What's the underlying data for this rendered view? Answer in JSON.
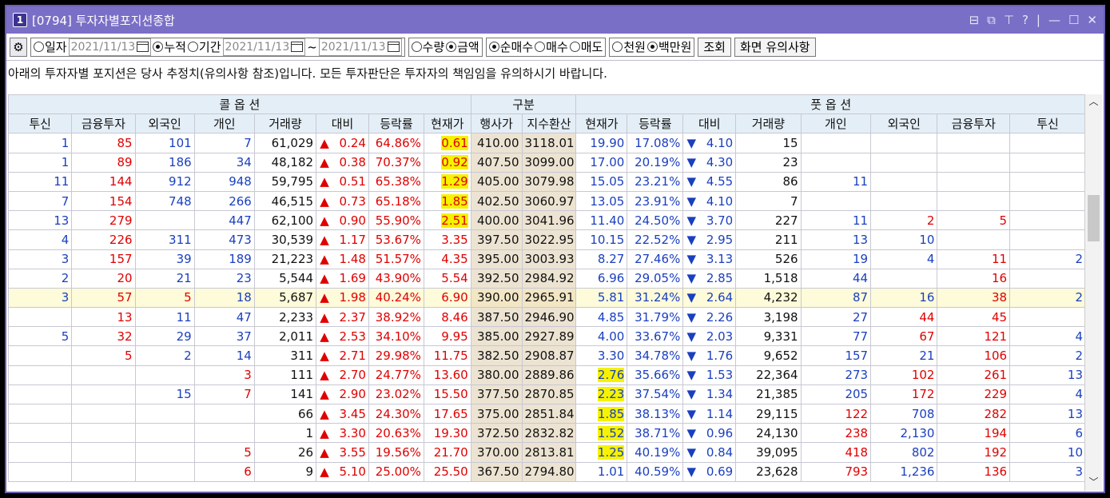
{
  "window": {
    "screen_no": "1",
    "title": "[0794]  투자자별포지션종합",
    "controls": [
      "⊟",
      "⧉",
      "⊤",
      "?",
      "|",
      "—",
      "☐",
      "✕"
    ]
  },
  "toolbar": {
    "radio_daily": "일자",
    "date_single": "2021/11/13",
    "radio_cumulative": "누적",
    "radio_period": "기간",
    "date_from": "2021/11/13",
    "tilde": "~",
    "date_to": "2021/11/13",
    "radio_qty": "수량",
    "radio_amount": "금액",
    "radio_net": "순매수",
    "radio_buy": "매수",
    "radio_sell": "매도",
    "radio_thousand": "천원",
    "radio_million": "백만원",
    "query_button": "조회",
    "notice_button": "화면 유의사항"
  },
  "notice": "아래의 투자자별 포지션은 당사 추정치(유의사항 참조)입니다. 모든 투자판단은 투자자의 책임임을 유의하시기 바랍니다.",
  "header": {
    "call": "콜 옵 션",
    "div": "구분",
    "put": "풋 옵 션",
    "cols": [
      "투신",
      "금융투자",
      "외국인",
      "개인",
      "거래량",
      "대비",
      "등락률",
      "현재가",
      "행사가",
      "지수환산",
      "현재가",
      "등락률",
      "대비",
      "거래량",
      "개인",
      "외국인",
      "금융투자",
      "투신"
    ]
  },
  "symbols": {
    "up": "▲",
    "down": "▼"
  },
  "rows": [
    [
      "1",
      "85",
      "101",
      "7",
      "61,029",
      "0.24",
      "64.86%",
      "0.61",
      "410.00",
      "3118.01",
      "19.90",
      "17.08%",
      "4.10",
      "15",
      "",
      "",
      "",
      ""
    ],
    [
      "1",
      "89",
      "186",
      "34",
      "48,182",
      "0.38",
      "70.37%",
      "0.92",
      "407.50",
      "3099.00",
      "17.00",
      "20.19%",
      "4.30",
      "23",
      "",
      "",
      "",
      ""
    ],
    [
      "11",
      "144",
      "912",
      "948",
      "59,795",
      "0.51",
      "65.38%",
      "1.29",
      "405.00",
      "3079.98",
      "15.05",
      "23.21%",
      "4.55",
      "86",
      "11",
      "",
      "",
      ""
    ],
    [
      "7",
      "154",
      "748",
      "266",
      "46,515",
      "0.73",
      "65.18%",
      "1.85",
      "402.50",
      "3060.97",
      "13.05",
      "23.91%",
      "4.10",
      "7",
      "",
      "",
      "",
      ""
    ],
    [
      "13",
      "279",
      "",
      "447",
      "62,100",
      "0.90",
      "55.90%",
      "2.51",
      "400.00",
      "3041.96",
      "11.40",
      "24.50%",
      "3.70",
      "227",
      "11",
      "2",
      "5",
      ""
    ],
    [
      "4",
      "226",
      "311",
      "473",
      "30,539",
      "1.17",
      "53.67%",
      "3.35",
      "397.50",
      "3022.95",
      "10.15",
      "22.52%",
      "2.95",
      "211",
      "13",
      "10",
      "",
      ""
    ],
    [
      "3",
      "157",
      "39",
      "189",
      "21,223",
      "1.48",
      "51.57%",
      "4.35",
      "395.00",
      "3003.93",
      "8.27",
      "27.46%",
      "3.13",
      "526",
      "19",
      "4",
      "11",
      "2"
    ],
    [
      "2",
      "20",
      "21",
      "23",
      "5,544",
      "1.69",
      "43.90%",
      "5.54",
      "392.50",
      "2984.92",
      "6.96",
      "29.05%",
      "2.85",
      "1,518",
      "44",
      "",
      "16",
      ""
    ],
    [
      "3",
      "57",
      "5",
      "18",
      "5,687",
      "1.98",
      "40.24%",
      "6.90",
      "390.00",
      "2965.91",
      "5.81",
      "31.24%",
      "2.64",
      "4,232",
      "87",
      "16",
      "38",
      "2"
    ],
    [
      "",
      "13",
      "11",
      "47",
      "2,233",
      "2.37",
      "38.92%",
      "8.46",
      "387.50",
      "2946.90",
      "4.85",
      "31.79%",
      "2.26",
      "3,198",
      "27",
      "44",
      "45",
      ""
    ],
    [
      "5",
      "32",
      "29",
      "37",
      "2,011",
      "2.53",
      "34.10%",
      "9.95",
      "385.00",
      "2927.89",
      "4.00",
      "33.67%",
      "2.03",
      "9,331",
      "77",
      "67",
      "121",
      "4"
    ],
    [
      "",
      "5",
      "2",
      "14",
      "311",
      "2.71",
      "29.98%",
      "11.75",
      "382.50",
      "2908.87",
      "3.30",
      "34.78%",
      "1.76",
      "9,652",
      "157",
      "21",
      "106",
      "2"
    ],
    [
      "",
      "",
      "",
      "3",
      "111",
      "2.70",
      "24.77%",
      "13.60",
      "380.00",
      "2889.86",
      "2.76",
      "35.66%",
      "1.53",
      "22,364",
      "273",
      "102",
      "261",
      "13"
    ],
    [
      "",
      "",
      "15",
      "7",
      "141",
      "2.90",
      "23.02%",
      "15.50",
      "377.50",
      "2870.85",
      "2.23",
      "37.54%",
      "1.34",
      "21,385",
      "205",
      "172",
      "229",
      "4"
    ],
    [
      "",
      "",
      "",
      "",
      "66",
      "3.45",
      "24.30%",
      "17.65",
      "375.00",
      "2851.84",
      "1.85",
      "38.13%",
      "1.14",
      "29,115",
      "122",
      "708",
      "282",
      "13"
    ],
    [
      "",
      "",
      "",
      "",
      "1",
      "3.30",
      "20.63%",
      "19.30",
      "372.50",
      "2832.82",
      "1.52",
      "38.71%",
      "0.96",
      "24,130",
      "238",
      "2,130",
      "194",
      "6"
    ],
    [
      "",
      "",
      "",
      "5",
      "26",
      "3.55",
      "19.56%",
      "21.70",
      "370.00",
      "2813.81",
      "1.25",
      "40.19%",
      "0.84",
      "39,095",
      "418",
      "802",
      "192",
      "10"
    ],
    [
      "",
      "",
      "",
      "6",
      "9",
      "5.10",
      "25.00%",
      "25.50",
      "367.50",
      "2794.80",
      "1.01",
      "40.59%",
      "0.69",
      "23,628",
      "793",
      "1,236",
      "136",
      "3"
    ]
  ],
  "call_highlight_rows": [
    0,
    1,
    2,
    3,
    4
  ],
  "put_highlight_rows": [
    12,
    13,
    14,
    15,
    16
  ],
  "atm_row": 8,
  "colors": {
    "title_bg": "#7a6fc6",
    "header_bg": "#e4eef6",
    "strike_bg": "#ece3d2",
    "up": "#e00000",
    "down": "#1a3fbf",
    "highlight": "#f6f200"
  }
}
